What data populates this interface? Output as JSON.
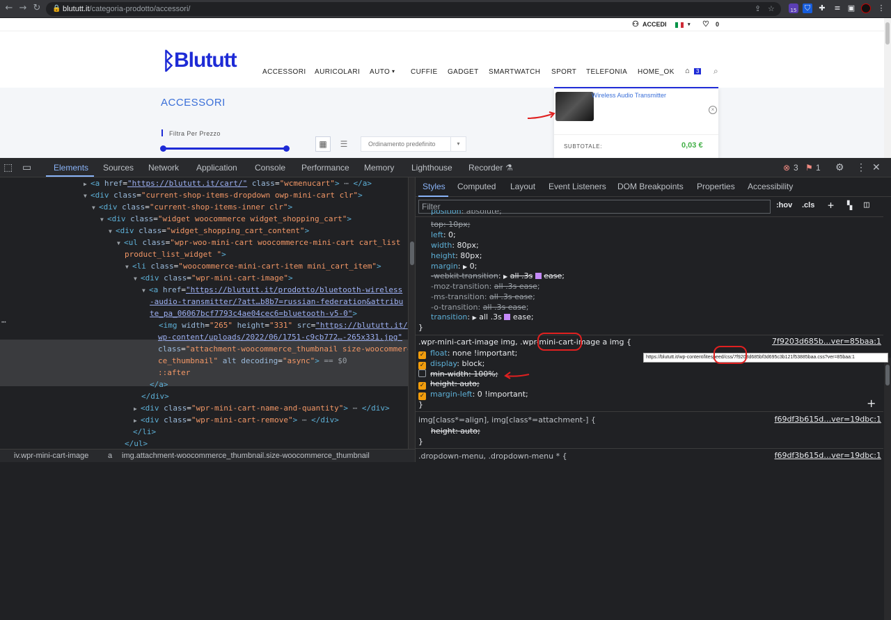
{
  "browser": {
    "url_host": "blututt.it",
    "url_path": "/categoria-prodotto/accessori/",
    "ext_badge": "15"
  },
  "site": {
    "topbar": {
      "accedi": "ACCEDI",
      "wishlist_count": "0"
    },
    "logo": "Blututt",
    "menu": [
      "ACCESSORI",
      "AURICOLARI",
      "AUTO",
      "CUFFIE",
      "GADGET",
      "SMARTWATCH",
      "SPORT",
      "TELEFONIA",
      "HOME_OK"
    ],
    "cart_count": "3",
    "page_title": "ACCESSORI",
    "filter_label": "Filtra Per Prezzo",
    "sort_label": "Ordinamento predefinito",
    "minicart": {
      "item_name": "Wireless Audio Transmitter",
      "subtotal_label": "SUBTOTALE:",
      "subtotal_value": "0,03 €"
    }
  },
  "devtools": {
    "tabs": [
      "Elements",
      "Sources",
      "Network",
      "Application",
      "Console",
      "Performance",
      "Memory",
      "Lighthouse",
      "Recorder"
    ],
    "errors": "3",
    "warnings": "1",
    "breadcrumbs": [
      "iv.wpr-mini-cart-image",
      "a",
      "img.attachment-woocommerce_thumbnail.size-woocommerce_thumbnail"
    ],
    "style_tabs": [
      "Styles",
      "Computed",
      "Layout",
      "Event Listeners",
      "DOM Breakpoints",
      "Properties",
      "Accessibility"
    ],
    "filter_placeholder": "Filter",
    "hov": ":hov",
    "cls": ".cls",
    "tooltip": "https://blututt.it/wp-content/litespeed/css/7f9203d685bf3d695c3b121f53885baa.css?ver=85baa:1",
    "rules": {
      "rule1_source": "7f9203d685b…ver=85baa:1",
      "rule2_source": "f69df3b615d…ver=19dbc:1",
      "rule3_source": "f69df3b615d…ver=19dbc:1"
    }
  }
}
